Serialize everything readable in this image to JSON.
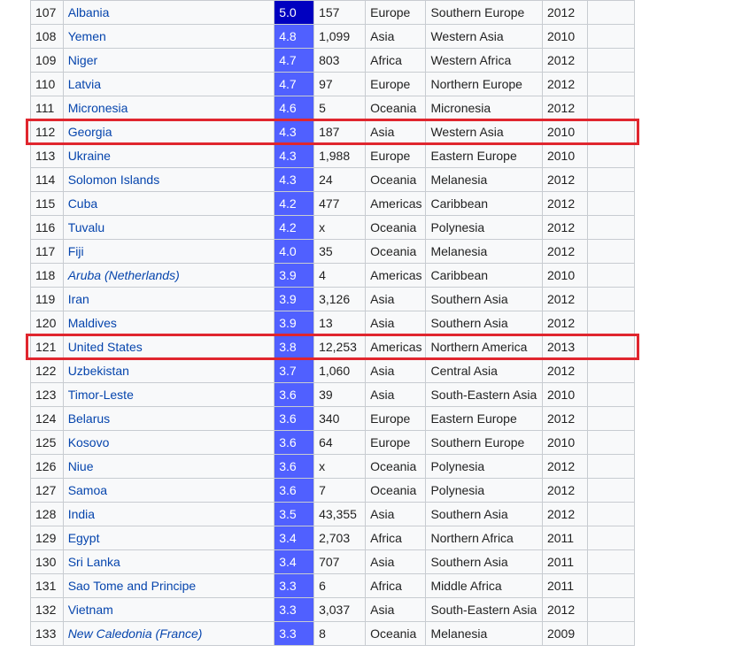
{
  "rows": [
    {
      "rank": "107",
      "country": "Albania",
      "rate": "5.0",
      "count": "157",
      "region": "Europe",
      "subregion": "Southern Europe",
      "year": "2012"
    },
    {
      "rank": "108",
      "country": "Yemen",
      "rate": "4.8",
      "count": "1,099",
      "region": "Asia",
      "subregion": "Western Asia",
      "year": "2010"
    },
    {
      "rank": "109",
      "country": "Niger",
      "rate": "4.7",
      "count": "803",
      "region": "Africa",
      "subregion": "Western Africa",
      "year": "2012"
    },
    {
      "rank": "110",
      "country": "Latvia",
      "rate": "4.7",
      "count": "97",
      "region": "Europe",
      "subregion": "Northern Europe",
      "year": "2012"
    },
    {
      "rank": "111",
      "country": "Micronesia",
      "rate": "4.6",
      "count": "5",
      "region": "Oceania",
      "subregion": "Micronesia",
      "year": "2012"
    },
    {
      "rank": "112",
      "country": "Georgia",
      "rate": "4.3",
      "count": "187",
      "region": "Asia",
      "subregion": "Western Asia",
      "year": "2010"
    },
    {
      "rank": "113",
      "country": "Ukraine",
      "rate": "4.3",
      "count": "1,988",
      "region": "Europe",
      "subregion": "Eastern Europe",
      "year": "2010"
    },
    {
      "rank": "114",
      "country": "Solomon Islands",
      "rate": "4.3",
      "count": "24",
      "region": "Oceania",
      "subregion": "Melanesia",
      "year": "2012"
    },
    {
      "rank": "115",
      "country": "Cuba",
      "rate": "4.2",
      "count": "477",
      "region": "Americas",
      "subregion": "Caribbean",
      "year": "2012"
    },
    {
      "rank": "116",
      "country": "Tuvalu",
      "rate": "4.2",
      "count": "x",
      "region": "Oceania",
      "subregion": "Polynesia",
      "year": "2012"
    },
    {
      "rank": "117",
      "country": "Fiji",
      "rate": "4.0",
      "count": "35",
      "region": "Oceania",
      "subregion": "Melanesia",
      "year": "2012"
    },
    {
      "rank": "118",
      "country": "Aruba",
      "country_paren": "(Netherlands)",
      "rate": "3.9",
      "count": "4",
      "region": "Americas",
      "subregion": "Caribbean",
      "year": "2010"
    },
    {
      "rank": "119",
      "country": "Iran",
      "rate": "3.9",
      "count": "3,126",
      "region": "Asia",
      "subregion": "Southern Asia",
      "year": "2012"
    },
    {
      "rank": "120",
      "country": "Maldives",
      "rate": "3.9",
      "count": "13",
      "region": "Asia",
      "subregion": "Southern Asia",
      "year": "2012"
    },
    {
      "rank": "121",
      "country": "United States",
      "rate": "3.8",
      "count": "12,253",
      "region": "Americas",
      "subregion": "Northern America",
      "year": "2013"
    },
    {
      "rank": "122",
      "country": "Uzbekistan",
      "rate": "3.7",
      "count": "1,060",
      "region": "Asia",
      "subregion": "Central Asia",
      "year": "2012"
    },
    {
      "rank": "123",
      "country": "Timor-Leste",
      "rate": "3.6",
      "count": "39",
      "region": "Asia",
      "subregion": "South-Eastern Asia",
      "year": "2010"
    },
    {
      "rank": "124",
      "country": "Belarus",
      "rate": "3.6",
      "count": "340",
      "region": "Europe",
      "subregion": "Eastern Europe",
      "year": "2012"
    },
    {
      "rank": "125",
      "country": "Kosovo",
      "rate": "3.6",
      "count": "64",
      "region": "Europe",
      "subregion": "Southern Europe",
      "year": "2010"
    },
    {
      "rank": "126",
      "country": "Niue",
      "rate": "3.6",
      "count": "x",
      "region": "Oceania",
      "subregion": "Polynesia",
      "year": "2012"
    },
    {
      "rank": "127",
      "country": "Samoa",
      "rate": "3.6",
      "count": "7",
      "region": "Oceania",
      "subregion": "Polynesia",
      "year": "2012"
    },
    {
      "rank": "128",
      "country": "India",
      "rate": "3.5",
      "count": "43,355",
      "region": "Asia",
      "subregion": "Southern Asia",
      "year": "2012"
    },
    {
      "rank": "129",
      "country": "Egypt",
      "rate": "3.4",
      "count": "2,703",
      "region": "Africa",
      "subregion": "Northern Africa",
      "year": "2011"
    },
    {
      "rank": "130",
      "country": "Sri Lanka",
      "rate": "3.4",
      "count": "707",
      "region": "Asia",
      "subregion": "Southern Asia",
      "year": "2011"
    },
    {
      "rank": "131",
      "country": "Sao Tome and Principe",
      "rate": "3.3",
      "count": "6",
      "region": "Africa",
      "subregion": "Middle Africa",
      "year": "2011"
    },
    {
      "rank": "132",
      "country": "Vietnam",
      "rate": "3.3",
      "count": "3,037",
      "region": "Asia",
      "subregion": "South-Eastern Asia",
      "year": "2012"
    },
    {
      "rank": "133",
      "country": "New Caledonia",
      "country_paren": "(France)",
      "rate": "3.3",
      "count": "8",
      "region": "Oceania",
      "subregion": "Melanesia",
      "year": "2009"
    }
  ],
  "highlighted_ranks": [
    "112",
    "121"
  ],
  "colors": {
    "link": "#0645ad",
    "rate_cell": "#5060ff",
    "rate_cell_top": "#0000c0",
    "highlight_border": "#e0262e"
  }
}
